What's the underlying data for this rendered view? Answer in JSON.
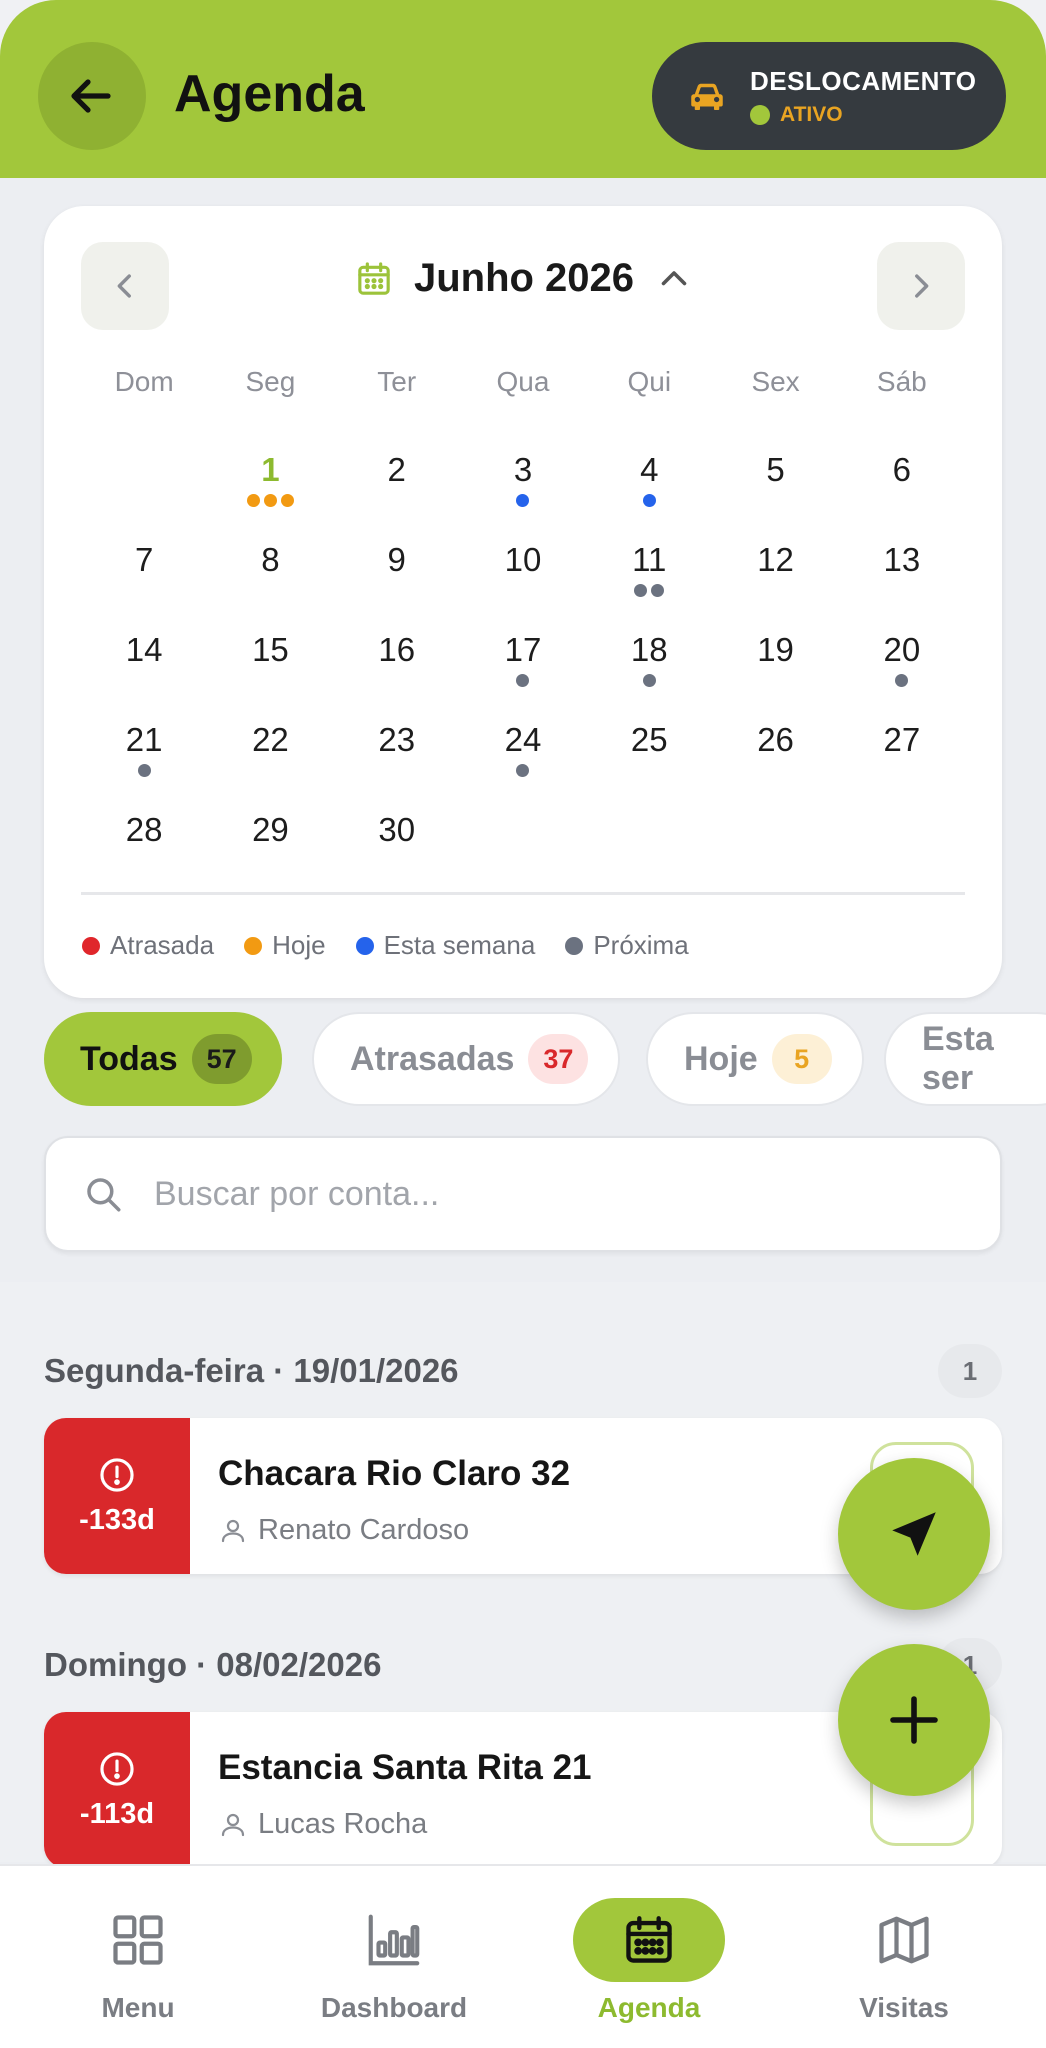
{
  "header": {
    "title": "Agenda",
    "trip": {
      "label": "DESLOCAMENTO",
      "status": "ATIVO"
    }
  },
  "calendar": {
    "month": "Junho 2026",
    "weekdays": [
      "Dom",
      "Seg",
      "Ter",
      "Qua",
      "Qui",
      "Sex",
      "Sáb"
    ],
    "start_offset": 1,
    "today": 1,
    "days": [
      {
        "n": "1",
        "dots": [
          "orange",
          "orange",
          "orange"
        ]
      },
      {
        "n": "2",
        "dots": []
      },
      {
        "n": "3",
        "dots": [
          "blue"
        ]
      },
      {
        "n": "4",
        "dots": [
          "blue"
        ]
      },
      {
        "n": "5",
        "dots": []
      },
      {
        "n": "6",
        "dots": []
      },
      {
        "n": "7",
        "dots": []
      },
      {
        "n": "8",
        "dots": []
      },
      {
        "n": "9",
        "dots": []
      },
      {
        "n": "10",
        "dots": []
      },
      {
        "n": "11",
        "dots": [
          "gray",
          "gray"
        ]
      },
      {
        "n": "12",
        "dots": []
      },
      {
        "n": "13",
        "dots": []
      },
      {
        "n": "14",
        "dots": []
      },
      {
        "n": "15",
        "dots": []
      },
      {
        "n": "16",
        "dots": []
      },
      {
        "n": "17",
        "dots": [
          "gray"
        ]
      },
      {
        "n": "18",
        "dots": [
          "gray"
        ]
      },
      {
        "n": "19",
        "dots": []
      },
      {
        "n": "20",
        "dots": [
          "gray"
        ]
      },
      {
        "n": "21",
        "dots": [
          "gray"
        ]
      },
      {
        "n": "22",
        "dots": []
      },
      {
        "n": "23",
        "dots": []
      },
      {
        "n": "24",
        "dots": [
          "gray"
        ]
      },
      {
        "n": "25",
        "dots": []
      },
      {
        "n": "26",
        "dots": []
      },
      {
        "n": "27",
        "dots": []
      },
      {
        "n": "28",
        "dots": []
      },
      {
        "n": "29",
        "dots": []
      },
      {
        "n": "30",
        "dots": []
      }
    ],
    "legend": [
      {
        "label": "Atrasada",
        "color": "red"
      },
      {
        "label": "Hoje",
        "color": "orange"
      },
      {
        "label": "Esta semana",
        "color": "blue"
      },
      {
        "label": "Próxima",
        "color": "gray"
      }
    ]
  },
  "colors": {
    "red": "#e0262b",
    "orange": "#f29a12",
    "blue": "#2563eb",
    "gray": "#6b7280",
    "accent": "#a2c73b",
    "overdue": "#d9282b"
  },
  "filters": [
    {
      "label": "Todas",
      "count": "57"
    },
    {
      "label": "Atrasadas",
      "count": "37"
    },
    {
      "label": "Hoje",
      "count": "5"
    },
    {
      "label": "Esta ser"
    }
  ],
  "search": {
    "placeholder": "Buscar por conta..."
  },
  "groups": [
    {
      "date": "Segunda-feira · 19/01/2026",
      "count": "1",
      "visit": {
        "name": "Chacara Rio Claro 32",
        "person": "Renato Cardoso",
        "late": "-133d"
      }
    },
    {
      "date": "Domingo · 08/02/2026",
      "count": "1",
      "visit": {
        "name": "Estancia Santa Rita 21",
        "person": "Lucas Rocha",
        "late": "-113d"
      }
    }
  ],
  "nav": [
    {
      "label": "Menu",
      "icon": "grid-icon"
    },
    {
      "label": "Dashboard",
      "icon": "bar-chart-icon"
    },
    {
      "label": "Agenda",
      "icon": "calendar-icon"
    },
    {
      "label": "Visitas",
      "icon": "map-icon"
    }
  ]
}
